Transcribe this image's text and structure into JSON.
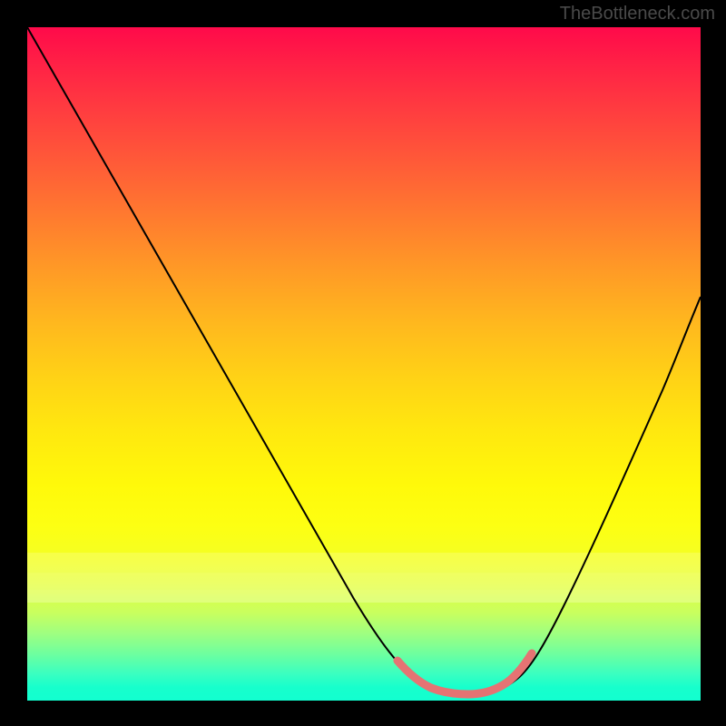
{
  "watermark": "TheBottleneck.com",
  "chart_data": {
    "type": "line",
    "title": "",
    "xlabel": "",
    "ylabel": "",
    "xlim": [
      0,
      100
    ],
    "ylim": [
      0,
      100
    ],
    "grid": false,
    "legend": false,
    "annotations": [],
    "series": [
      {
        "name": "bottleneck-curve",
        "x": [
          0,
          7,
          14,
          21,
          28,
          35,
          42,
          49,
          55,
          58,
          61,
          64,
          67,
          70,
          73,
          76,
          82,
          88,
          94,
          100
        ],
        "values": [
          100,
          88,
          76,
          64,
          52,
          40,
          28,
          16,
          6,
          3,
          2,
          1.5,
          1.5,
          2,
          4,
          8,
          20,
          33,
          46,
          60
        ]
      }
    ],
    "highlight": {
      "name": "optimal-range",
      "x_start": 55,
      "x_end": 76,
      "description": "low bottleneck region (pink segment)"
    },
    "gradient": {
      "top_color": "#ff0a4a",
      "mid_color": "#fff90a",
      "bottom_color": "#12ffd0"
    }
  }
}
